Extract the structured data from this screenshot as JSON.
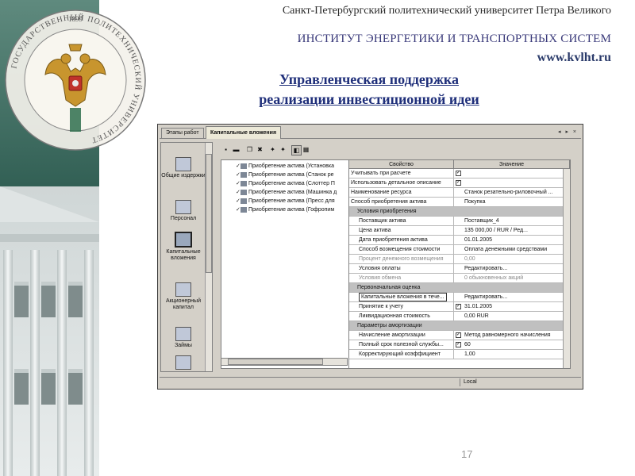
{
  "header": {
    "university": "Санкт-Петербургский политехнический университет Петра Великого",
    "institute": "ИНСТИТУТ ЭНЕРГЕТИКИ И ТРАНСПОРТНЫХ СИСТЕМ",
    "website": "www.kvlht.ru",
    "title_line1": "Управленческая поддержка",
    "title_line2": "реализации инвестиционной идеи",
    "page_number": "17"
  },
  "emblem": {
    "year": "1899",
    "ring_text": "ГОСУДАРСТВЕННЫЙ ПОЛИТЕХНИЧЕСКИЙ УНИВЕРСИТЕТ"
  },
  "app": {
    "tabs": [
      {
        "label": "Этапы работ",
        "active": false
      },
      {
        "label": "Капитальные вложения",
        "active": true
      }
    ],
    "tab_nav": "◂ ▸ ×",
    "sidebar": [
      {
        "label": "Общие издержки",
        "icon": "documents-icon"
      },
      {
        "label": "Персонал",
        "icon": "person-icon"
      },
      {
        "label": "Капитальные вложения",
        "icon": "box-icon",
        "selected": true
      },
      {
        "label": "Акционерный капитал",
        "icon": "shares-icon"
      },
      {
        "label": "Займы",
        "icon": "loan-icon"
      },
      {
        "label": "",
        "icon": "calculator-icon"
      }
    ],
    "toolbar": [
      "new-icon",
      "open-folder-icon",
      "copy-icon",
      "delete-icon",
      "move-up-icon",
      "move-down-icon",
      "view-icon",
      "properties-icon"
    ],
    "list_items": [
      "Приобретение актива (Установка",
      "Приобретение актива (Станок ре",
      "Приобретение актива (Слоттер П",
      "Приобретение актива (Машинка д",
      "Приобретение актива (Пресс для",
      "Приобретение актива (Гофропим"
    ],
    "grid": {
      "col_property": "Свойство",
      "col_value": "Значение",
      "rows": [
        {
          "type": "row",
          "property": "Учитывать при расчете",
          "checkbox": true,
          "value": ""
        },
        {
          "type": "row",
          "property": "Использовать детальное описание",
          "checkbox": true,
          "value": ""
        },
        {
          "type": "row",
          "property": "Наименование ресурса",
          "value": "Станок резательно-риловочный ..."
        },
        {
          "type": "row",
          "property": "Способ приобретения актива",
          "value": "Покупка"
        },
        {
          "type": "group",
          "property": "Условия приобретения"
        },
        {
          "type": "row",
          "property": "Поставщик актива",
          "value": "Поставщик_4",
          "indent": true
        },
        {
          "type": "row",
          "property": "Цена актива",
          "value": "135 000,00 / RUR / Ред...",
          "indent": true
        },
        {
          "type": "row",
          "property": "Дата приобретения актива",
          "value": "01.01.2005",
          "indent": true
        },
        {
          "type": "row",
          "property": "Способ возмещения стоимости",
          "value": "Оплата денежными средствами",
          "indent": true
        },
        {
          "type": "row",
          "property": "Процент денежного возмещения",
          "value": "0,00",
          "indent": true,
          "dim": true
        },
        {
          "type": "row",
          "property": "Условия оплаты",
          "value": "Редактировать...",
          "indent": true
        },
        {
          "type": "row",
          "property": "Условия обмена",
          "value": "0 обыкновенных акций",
          "indent": true,
          "dim": true
        },
        {
          "type": "group",
          "property": "Первоначальная оценка"
        },
        {
          "type": "row",
          "property": "Капитальные вложения в тече...",
          "value": "Редактировать...",
          "indent": true,
          "boxed": true
        },
        {
          "type": "row",
          "property": "Принятие к учету",
          "checkbox": true,
          "value": "31.01.2005",
          "indent": true
        },
        {
          "type": "row",
          "property": "Ликвидационная стоимость",
          "value": "0,00 RUR",
          "indent": true
        },
        {
          "type": "group",
          "property": "Параметры амортизации"
        },
        {
          "type": "row",
          "property": "Начисление амортизации",
          "checkbox": true,
          "value": "Метод равномерного начисления",
          "indent": true
        },
        {
          "type": "row",
          "property": "Полный срок полезной службы...",
          "checkbox": true,
          "value": "60",
          "indent": true
        },
        {
          "type": "row",
          "property": "Корректирующий коэффициент",
          "value": "1,00",
          "indent": true
        }
      ]
    },
    "status": "Local"
  },
  "colors": {
    "title": "#1f2f7a",
    "strip": "#2f5d52",
    "window": "#d4d0c8"
  }
}
